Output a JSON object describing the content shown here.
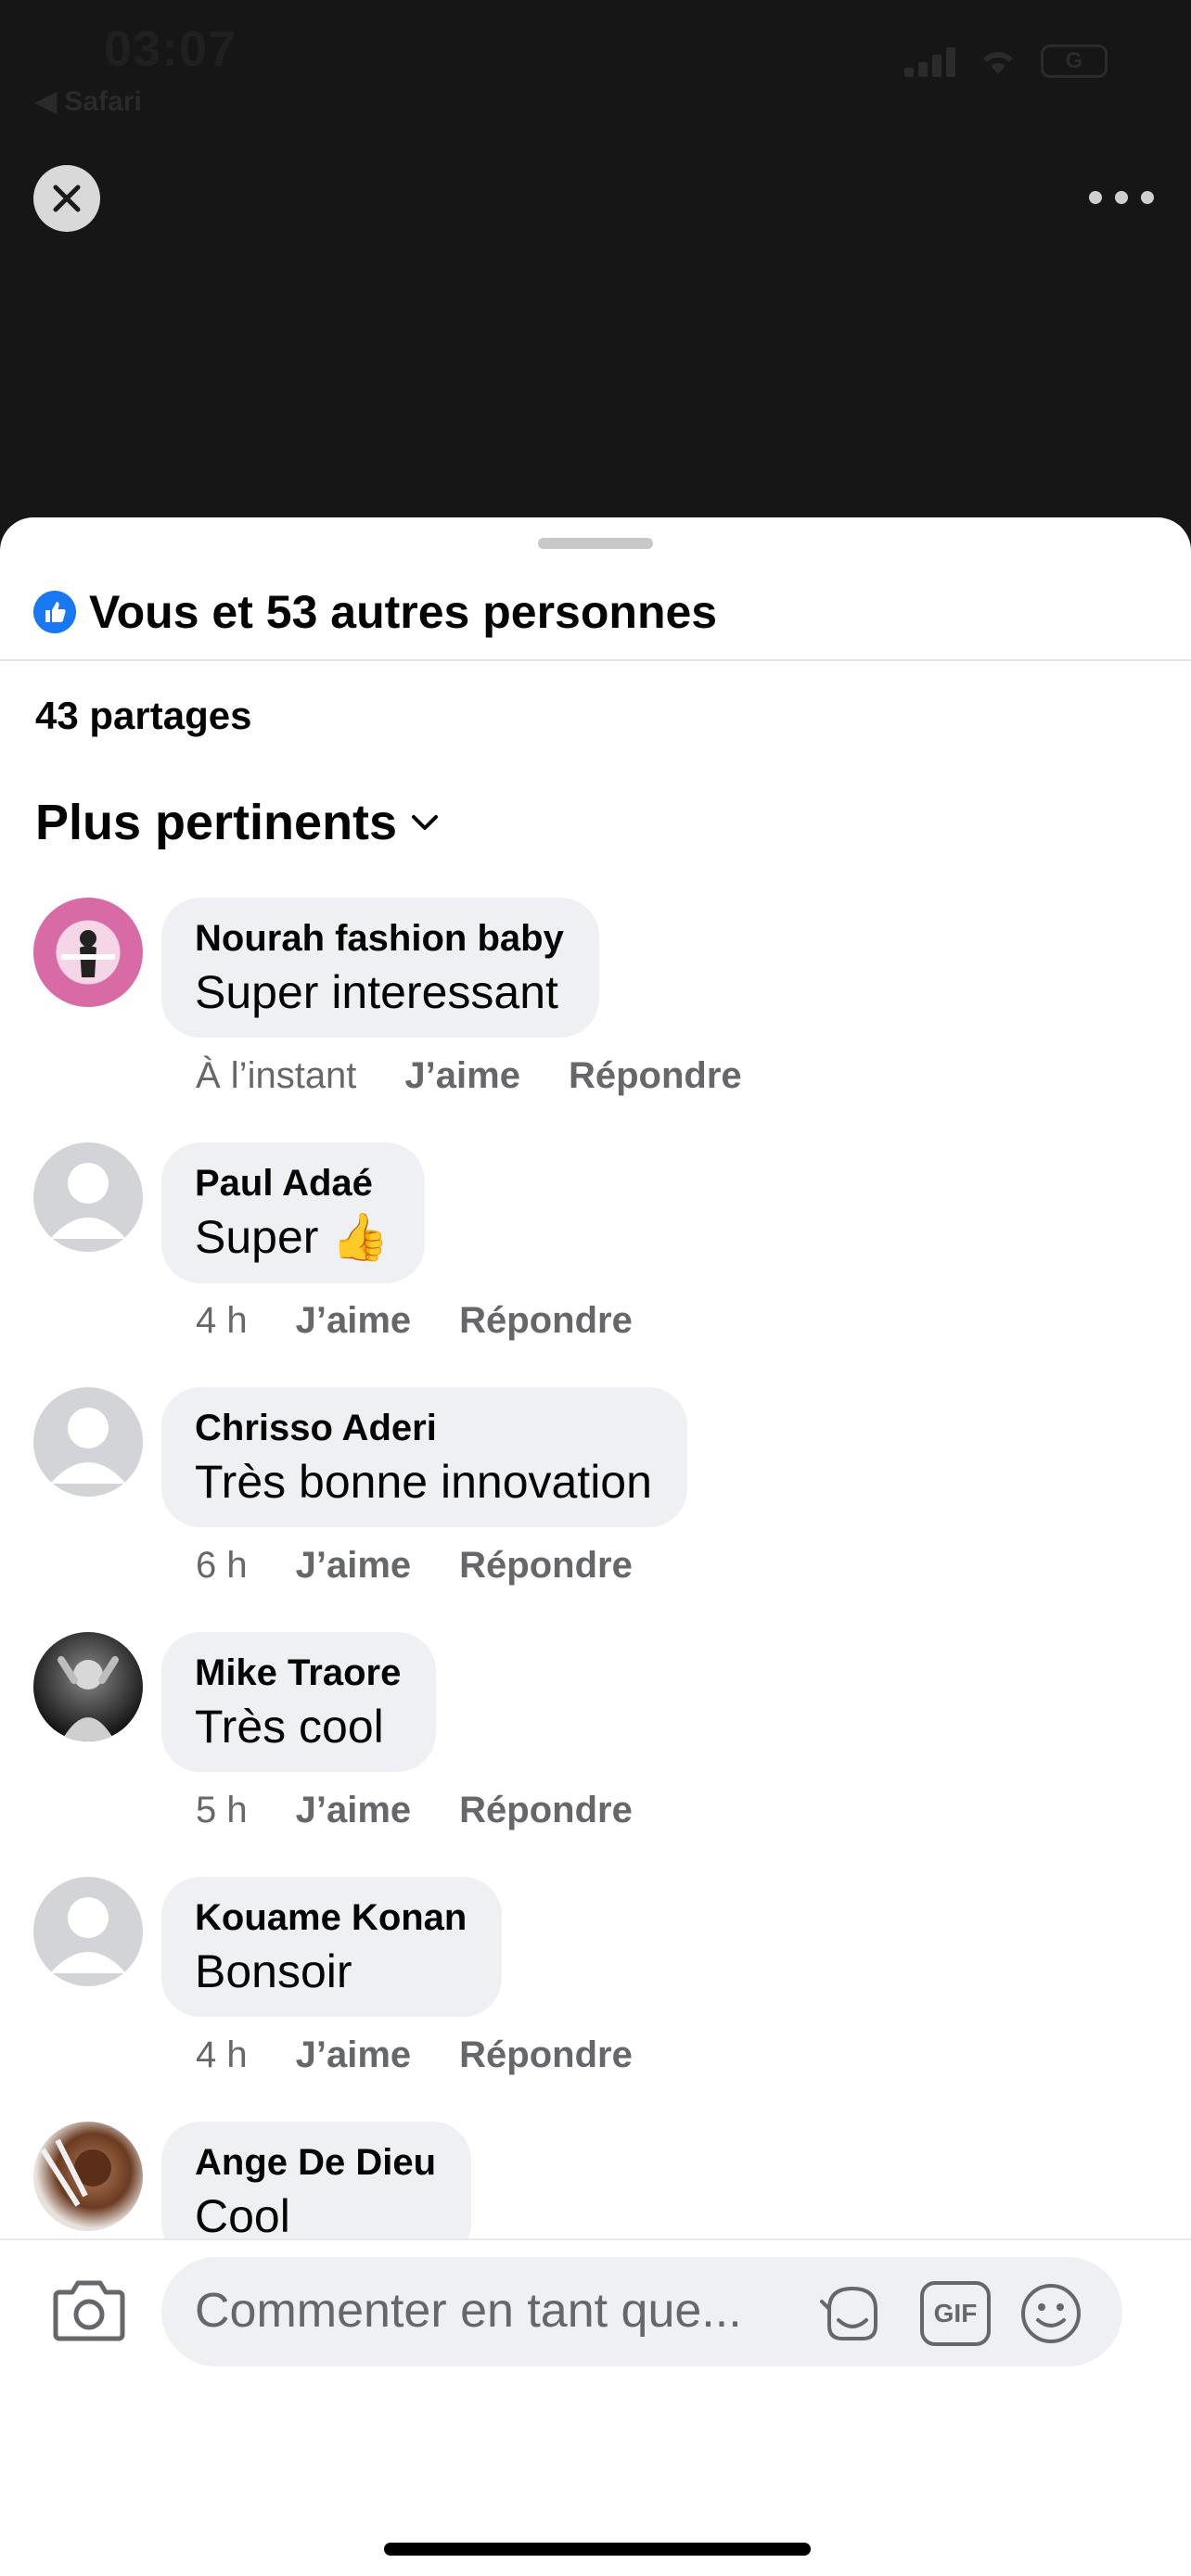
{
  "status_bar": {
    "time": "03:07",
    "back_app": "◀ Safari",
    "battery": "G"
  },
  "header": {
    "close_icon": "close-icon",
    "more_icon": "more-horizontal-icon"
  },
  "sheet": {
    "reactions_summary": "Vous et 53 autres personnes",
    "shares": "43 partages",
    "sort_label": "Plus pertinents"
  },
  "comments": [
    {
      "author": "Nourah fashion baby",
      "text": "Super interessant",
      "time": "À l’instant",
      "like": "J’aime",
      "reply": "Répondre"
    },
    {
      "author": "Paul Adaé",
      "text": "Super 👍",
      "time": "4 h",
      "like": "J’aime",
      "reply": "Répondre"
    },
    {
      "author": "Chrisso Aderi",
      "text": "Très bonne innovation",
      "time": "6 h",
      "like": "J’aime",
      "reply": "Répondre"
    },
    {
      "author": "Mike Traore",
      "text": "Très cool",
      "time": "5 h",
      "like": "J’aime",
      "reply": "Répondre"
    },
    {
      "author": "Kouame Konan",
      "text": "Bonsoir",
      "time": "4 h",
      "like": "J’aime",
      "reply": "Répondre"
    },
    {
      "author": "Ange De Dieu",
      "text": "Cool"
    }
  ],
  "composer": {
    "placeholder": "Commenter en tant que...",
    "gif_label": "GIF"
  },
  "colors": {
    "accent": "#1877f2",
    "bubble": "#eff0f3",
    "meta": "#65676b"
  }
}
